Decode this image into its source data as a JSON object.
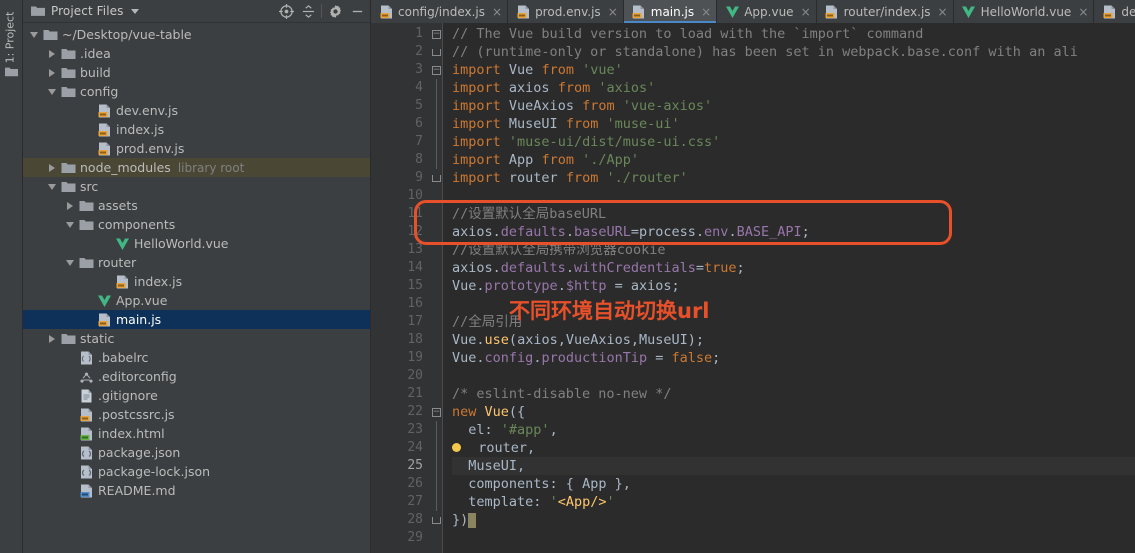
{
  "toolstrip": {
    "label": "1: Project",
    "folder_icon": "folder-icon"
  },
  "project_panel": {
    "title": "Project Files",
    "dropdown_icon": "chevron-down-icon",
    "actions": [
      {
        "name": "locate-icon",
        "label": "Select Opened File"
      },
      {
        "name": "collapse-all-icon",
        "label": "Collapse All"
      },
      {
        "name": "gear-icon",
        "label": "Settings"
      },
      {
        "name": "minimize-icon",
        "label": "Hide"
      }
    ],
    "tree": [
      {
        "label": "~/Desktop/vue-table",
        "indent": 0,
        "twisty": "down",
        "icon": "folder-icon",
        "state": "root"
      },
      {
        "label": ".idea",
        "indent": 1,
        "twisty": "right",
        "icon": "folder-icon",
        "state": "normal"
      },
      {
        "label": "build",
        "indent": 1,
        "twisty": "right",
        "icon": "folder-icon",
        "state": "normal"
      },
      {
        "label": "config",
        "indent": 1,
        "twisty": "down",
        "icon": "folder-icon",
        "state": "normal"
      },
      {
        "label": "dev.env.js",
        "indent": 3,
        "twisty": "none",
        "icon": "js-file-icon",
        "state": "normal"
      },
      {
        "label": "index.js",
        "indent": 3,
        "twisty": "none",
        "icon": "js-file-icon",
        "state": "normal"
      },
      {
        "label": "prod.env.js",
        "indent": 3,
        "twisty": "none",
        "icon": "js-file-icon",
        "state": "normal"
      },
      {
        "label": "node_modules",
        "indent": 1,
        "twisty": "right",
        "icon": "folder-icon",
        "state": "library",
        "sub": "library root"
      },
      {
        "label": "src",
        "indent": 1,
        "twisty": "down",
        "icon": "folder-icon",
        "state": "normal"
      },
      {
        "label": "assets",
        "indent": 2,
        "twisty": "right",
        "icon": "folder-icon",
        "state": "normal"
      },
      {
        "label": "components",
        "indent": 2,
        "twisty": "down",
        "icon": "folder-icon",
        "state": "normal"
      },
      {
        "label": "HelloWorld.vue",
        "indent": 4,
        "twisty": "none",
        "icon": "vue-file-icon",
        "state": "normal"
      },
      {
        "label": "router",
        "indent": 2,
        "twisty": "down",
        "icon": "folder-icon",
        "state": "normal"
      },
      {
        "label": "index.js",
        "indent": 4,
        "twisty": "none",
        "icon": "js-file-icon",
        "state": "normal"
      },
      {
        "label": "App.vue",
        "indent": 3,
        "twisty": "none",
        "icon": "vue-file-icon",
        "state": "normal"
      },
      {
        "label": "main.js",
        "indent": 3,
        "twisty": "none",
        "icon": "js-file-icon",
        "state": "selected"
      },
      {
        "label": "static",
        "indent": 1,
        "twisty": "right",
        "icon": "folder-icon",
        "state": "normal"
      },
      {
        "label": ".babelrc",
        "indent": 2,
        "twisty": "none",
        "icon": "babel-file-icon",
        "state": "normal"
      },
      {
        "label": ".editorconfig",
        "indent": 2,
        "twisty": "none",
        "icon": "config-file-icon",
        "state": "normal"
      },
      {
        "label": ".gitignore",
        "indent": 2,
        "twisty": "none",
        "icon": "text-file-icon",
        "state": "normal"
      },
      {
        "label": ".postcssrc.js",
        "indent": 2,
        "twisty": "none",
        "icon": "js-file-icon",
        "state": "normal"
      },
      {
        "label": "index.html",
        "indent": 2,
        "twisty": "none",
        "icon": "html-file-icon",
        "state": "normal"
      },
      {
        "label": "package.json",
        "indent": 2,
        "twisty": "none",
        "icon": "json-file-icon",
        "state": "normal"
      },
      {
        "label": "package-lock.json",
        "indent": 2,
        "twisty": "none",
        "icon": "json-file-icon",
        "state": "normal"
      },
      {
        "label": "README.md",
        "indent": 2,
        "twisty": "none",
        "icon": "md-file-icon",
        "state": "normal"
      }
    ]
  },
  "editor": {
    "tabs": [
      {
        "label": "config/index.js",
        "icon": "js-file-icon",
        "active": false,
        "close": "×"
      },
      {
        "label": "prod.env.js",
        "icon": "js-file-icon",
        "active": false,
        "close": "×"
      },
      {
        "label": "main.js",
        "icon": "js-file-icon",
        "active": true,
        "close": "×"
      },
      {
        "label": "App.vue",
        "icon": "vue-file-icon",
        "active": false,
        "close": "×"
      },
      {
        "label": "router/index.js",
        "icon": "js-file-icon",
        "active": false,
        "close": "×"
      },
      {
        "label": "HelloWorld.vue",
        "icon": "vue-file-icon",
        "active": false,
        "close": "×"
      },
      {
        "label": "dev.env.js",
        "icon": "js-file-icon",
        "active": false,
        "close": "×"
      }
    ],
    "current_line": 25,
    "first_line": 1,
    "last_line": 29,
    "lines": [
      {
        "n": 1,
        "fold": "minus",
        "text": "// The Vue build version to load with the `import` command"
      },
      {
        "n": 2,
        "fold": "end",
        "text": "// (runtime-only or standalone) has been set in webpack.base.conf with an ali"
      },
      {
        "n": 3,
        "fold": "minus",
        "text": "import Vue from 'vue'"
      },
      {
        "n": 4,
        "fold": "bar",
        "text": "import axios from 'axios'"
      },
      {
        "n": 5,
        "fold": "bar",
        "text": "import VueAxios from 'vue-axios'"
      },
      {
        "n": 6,
        "fold": "bar",
        "text": "import MuseUI from 'muse-ui'"
      },
      {
        "n": 7,
        "fold": "bar",
        "text": "import 'muse-ui/dist/muse-ui.css'"
      },
      {
        "n": 8,
        "fold": "bar",
        "text": "import App from './App'"
      },
      {
        "n": 9,
        "fold": "end",
        "text": "import router from './router'"
      },
      {
        "n": 10,
        "fold": "none",
        "text": ""
      },
      {
        "n": 11,
        "fold": "none",
        "text": "//设置默认全局baseURL"
      },
      {
        "n": 12,
        "fold": "none",
        "text": "axios.defaults.baseURL=process.env.BASE_API;"
      },
      {
        "n": 13,
        "fold": "none",
        "text": "//设置默认全局携带浏览器cookie"
      },
      {
        "n": 14,
        "fold": "none",
        "text": "axios.defaults.withCredentials=true;"
      },
      {
        "n": 15,
        "fold": "none",
        "text": "Vue.prototype.$http = axios;"
      },
      {
        "n": 16,
        "fold": "none",
        "text": ""
      },
      {
        "n": 17,
        "fold": "none",
        "text": "//全局引用"
      },
      {
        "n": 18,
        "fold": "none",
        "text": "Vue.use(axios,VueAxios,MuseUI);"
      },
      {
        "n": 19,
        "fold": "none",
        "text": "Vue.config.productionTip = false;"
      },
      {
        "n": 20,
        "fold": "none",
        "text": ""
      },
      {
        "n": 21,
        "fold": "none",
        "text": "/* eslint-disable no-new */"
      },
      {
        "n": 22,
        "fold": "minus",
        "text": "new Vue({"
      },
      {
        "n": 23,
        "fold": "bar",
        "text": "  el: '#app',"
      },
      {
        "n": 24,
        "fold": "bar",
        "text": "  router,"
      },
      {
        "n": 25,
        "fold": "bar",
        "text": "  MuseUI,"
      },
      {
        "n": 26,
        "fold": "bar",
        "text": "  components: { App },"
      },
      {
        "n": 27,
        "fold": "bar",
        "text": "  template: '<App/>'"
      },
      {
        "n": 28,
        "fold": "end",
        "text": "})"
      },
      {
        "n": 29,
        "fold": "none",
        "text": ""
      }
    ]
  },
  "annotations": {
    "box_color": "#e8502a",
    "text_color": "#e8502a",
    "callout_text": "不同环境自动切换url"
  }
}
